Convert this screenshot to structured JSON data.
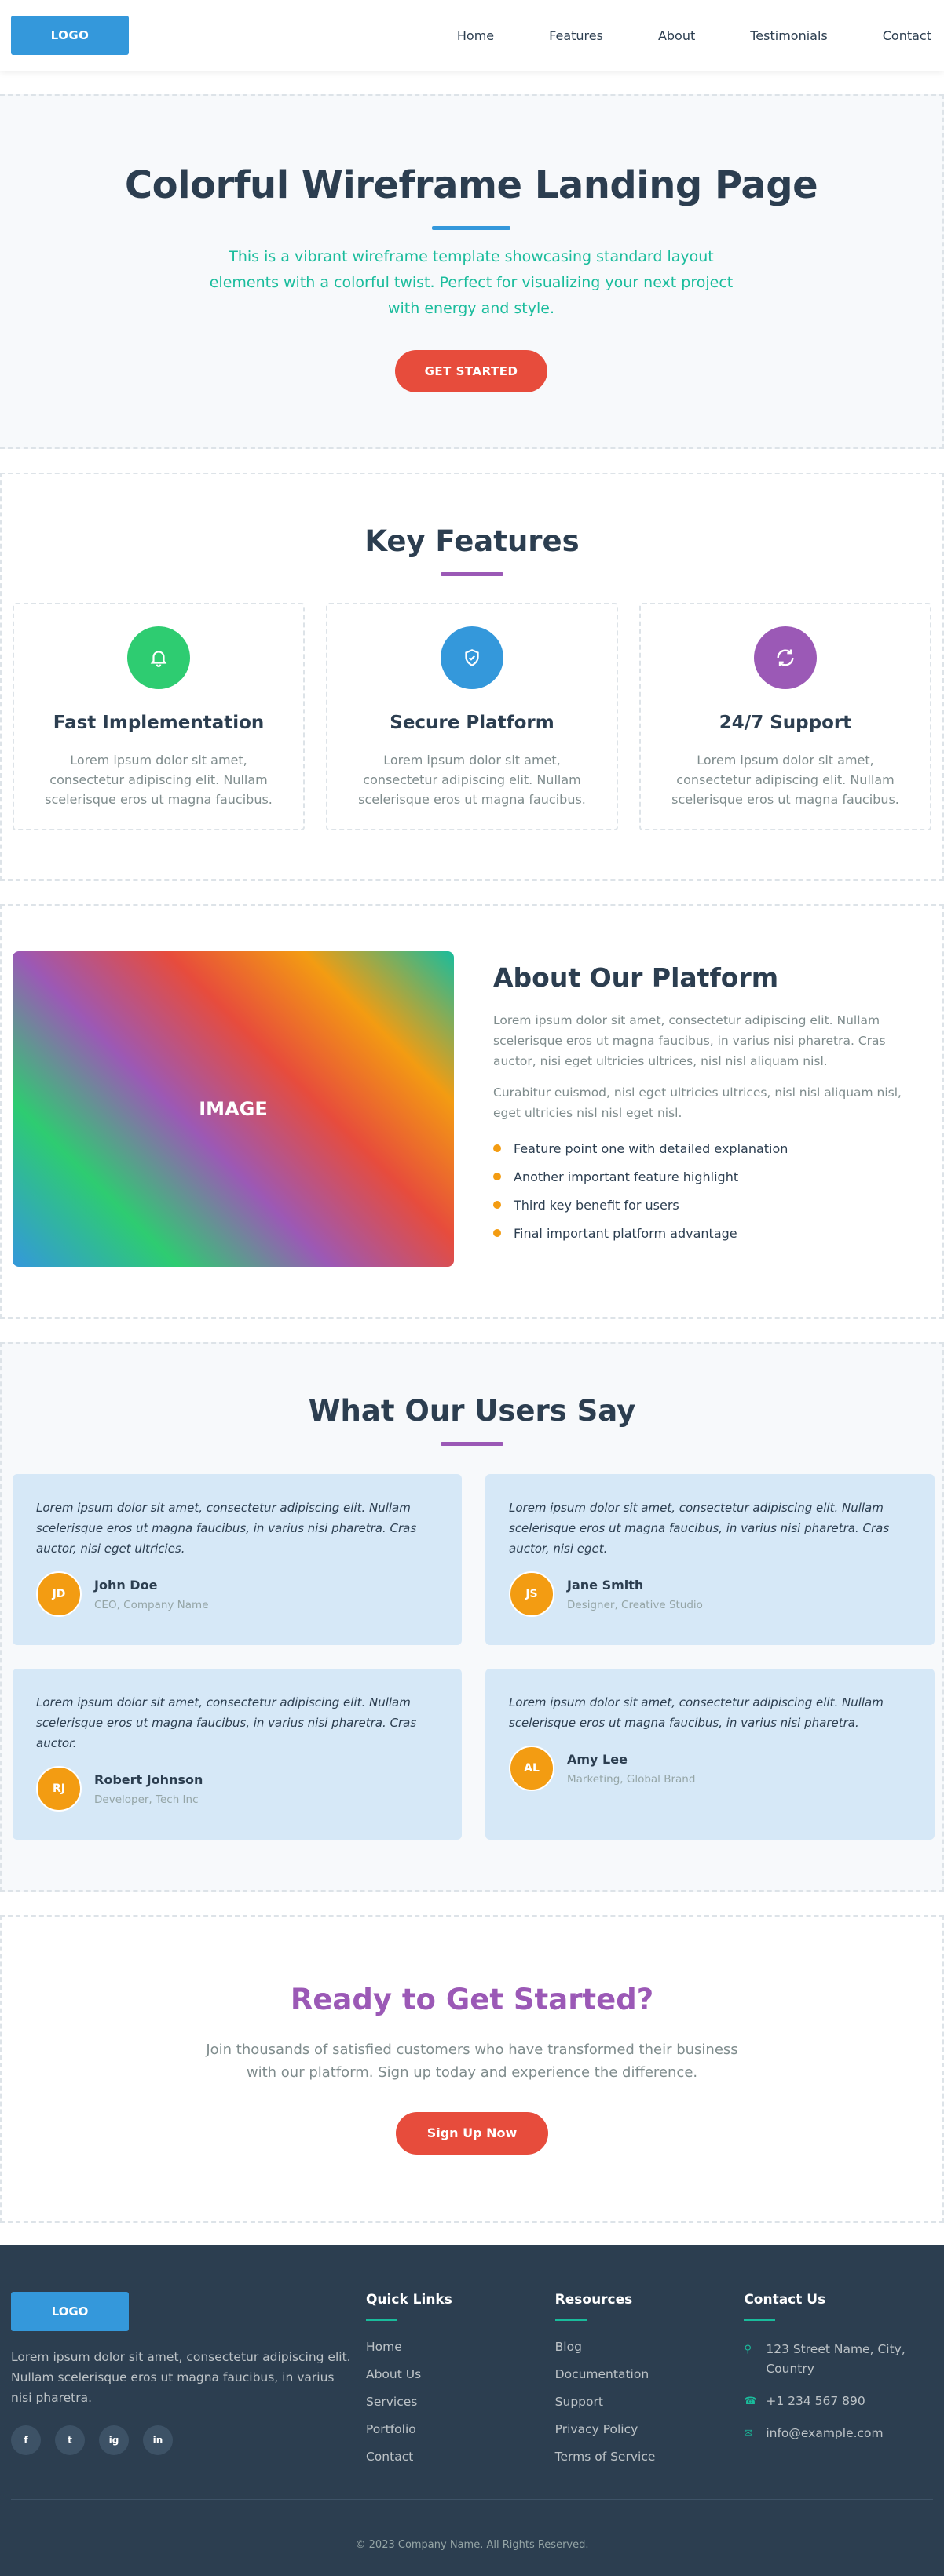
{
  "header": {
    "logo": "LOGO",
    "nav": [
      "Home",
      "Features",
      "About",
      "Testimonials",
      "Contact"
    ]
  },
  "hero": {
    "title": "Colorful Wireframe Landing Page",
    "subtitle": "This is a vibrant wireframe template showcasing standard layout elements with a colorful twist. Perfect for visualizing your next project with energy and style.",
    "cta": "GET STARTED"
  },
  "features": {
    "title": "Key Features",
    "items": [
      {
        "icon": "bell-icon",
        "title": "Fast Implementation",
        "text": "Lorem ipsum dolor sit amet, consectetur adipiscing elit. Nullam scelerisque eros ut magna faucibus.",
        "color": "#2ecc71"
      },
      {
        "icon": "shield-check-icon",
        "title": "Secure Platform",
        "text": "Lorem ipsum dolor sit amet, consectetur adipiscing elit. Nullam scelerisque eros ut magna faucibus.",
        "color": "#3498db"
      },
      {
        "icon": "refresh-24-icon",
        "title": "24/7 Support",
        "text": "Lorem ipsum dolor sit amet, consectetur adipiscing elit. Nullam scelerisque eros ut magna faucibus.",
        "color": "#9b59b6"
      }
    ]
  },
  "about": {
    "image_label": "IMAGE",
    "title": "About Our Platform",
    "p1": "Lorem ipsum dolor sit amet, consectetur adipiscing elit. Nullam scelerisque eros ut magna faucibus, in varius nisi pharetra. Cras auctor, nisi eget ultricies ultrices, nisl nisl aliquam nisl.",
    "p2": "Curabitur euismod, nisl eget ultricies ultrices, nisl nisl aliquam nisl, eget ultricies nisl nisl eget nisl.",
    "points": [
      "Feature point one with detailed explanation",
      "Another important feature highlight",
      "Third key benefit for users",
      "Final important platform advantage"
    ]
  },
  "testimonials": {
    "title": "What Our Users Say",
    "items": [
      {
        "quote": "Lorem ipsum dolor sit amet, consectetur adipiscing elit. Nullam scelerisque eros ut magna faucibus, in varius nisi pharetra. Cras auctor, nisi eget ultricies.",
        "initials": "JD",
        "name": "John Doe",
        "role": "CEO, Company Name"
      },
      {
        "quote": "Lorem ipsum dolor sit amet, consectetur adipiscing elit. Nullam scelerisque eros ut magna faucibus, in varius nisi pharetra. Cras auctor, nisi eget.",
        "initials": "JS",
        "name": "Jane Smith",
        "role": "Designer, Creative Studio"
      },
      {
        "quote": "Lorem ipsum dolor sit amet, consectetur adipiscing elit. Nullam scelerisque eros ut magna faucibus, in varius nisi pharetra. Cras auctor.",
        "initials": "RJ",
        "name": "Robert Johnson",
        "role": "Developer, Tech Inc"
      },
      {
        "quote": "Lorem ipsum dolor sit amet, consectetur adipiscing elit. Nullam scelerisque eros ut magna faucibus, in varius nisi pharetra.",
        "initials": "AL",
        "name": "Amy Lee",
        "role": "Marketing, Global Brand"
      }
    ]
  },
  "cta": {
    "title": "Ready to Get Started?",
    "text": "Join thousands of satisfied customers who have transformed their business with our platform. Sign up today and experience the difference.",
    "button": "Sign Up Now"
  },
  "footer": {
    "logo": "LOGO",
    "desc": "Lorem ipsum dolor sit amet, consectetur adipiscing elit. Nullam scelerisque eros ut magna faucibus, in varius nisi pharetra.",
    "social": [
      "f",
      "t",
      "ig",
      "in"
    ],
    "quick_links": {
      "title": "Quick Links",
      "items": [
        "Home",
        "About Us",
        "Services",
        "Portfolio",
        "Contact"
      ]
    },
    "resources": {
      "title": "Resources",
      "items": [
        "Blog",
        "Documentation",
        "Support",
        "Privacy Policy",
        "Terms of Service"
      ]
    },
    "contact": {
      "title": "Contact Us",
      "address": "123 Street Name, City, Country",
      "phone": "+1 234 567 890",
      "email": "info@example.com"
    },
    "copyright": "© 2023 Company Name. All Rights Reserved."
  },
  "colors": {
    "primary": "#3498db",
    "accent": "#e74c3c",
    "teal": "#1abc9c",
    "purple": "#9b59b6",
    "orange": "#f39c12",
    "dark": "#2c3e50"
  }
}
